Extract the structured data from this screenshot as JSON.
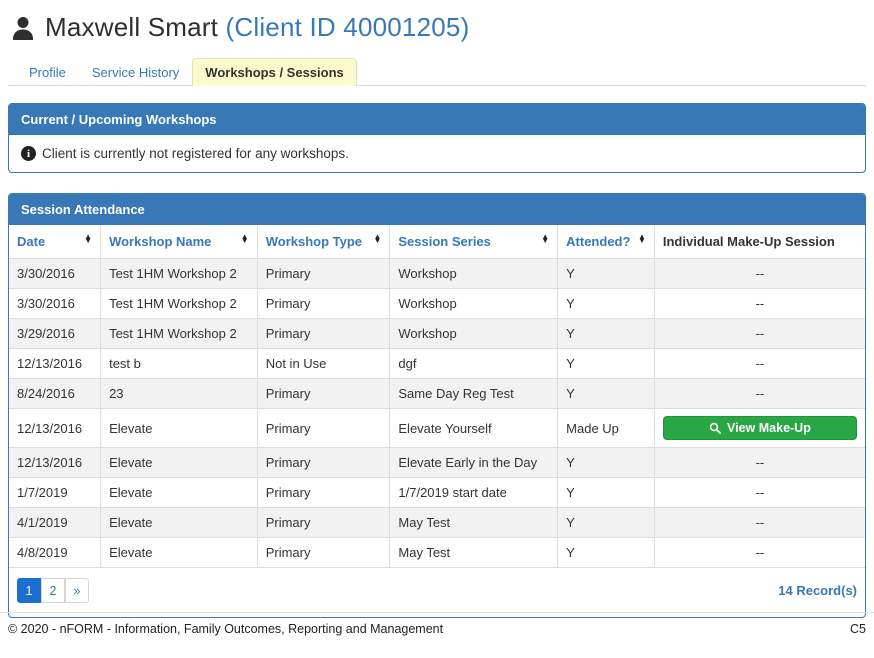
{
  "header": {
    "name": "Maxwell Smart",
    "client_id": "(Client ID 40001205)"
  },
  "tabs": [
    {
      "label": "Profile",
      "active": false
    },
    {
      "label": "Service History",
      "active": false
    },
    {
      "label": "Workshops / Sessions",
      "active": true
    }
  ],
  "panels": {
    "workshops": {
      "title": "Current / Upcoming Workshops",
      "message": "Client is currently not registered for any workshops."
    },
    "attendance": {
      "title": "Session Attendance",
      "columns": [
        {
          "label": "Date",
          "sortable": true
        },
        {
          "label": "Workshop Name",
          "sortable": true
        },
        {
          "label": "Workshop Type",
          "sortable": true
        },
        {
          "label": "Session Series",
          "sortable": true
        },
        {
          "label": "Attended?",
          "sortable": true
        },
        {
          "label": "Individual Make-Up Session",
          "sortable": false
        }
      ],
      "rows": [
        {
          "date": "3/30/2016",
          "workshop_name": "Test 1HM Workshop 2",
          "workshop_type": "Primary",
          "session_series": "Workshop",
          "attended": "Y",
          "make_up": "--"
        },
        {
          "date": "3/30/2016",
          "workshop_name": "Test 1HM Workshop 2",
          "workshop_type": "Primary",
          "session_series": "Workshop",
          "attended": "Y",
          "make_up": "--"
        },
        {
          "date": "3/29/2016",
          "workshop_name": "Test 1HM Workshop 2",
          "workshop_type": "Primary",
          "session_series": "Workshop",
          "attended": "Y",
          "make_up": "--"
        },
        {
          "date": "12/13/2016",
          "workshop_name": "test b",
          "workshop_type": "Not in Use",
          "session_series": "dgf",
          "attended": "Y",
          "make_up": "--"
        },
        {
          "date": "8/24/2016",
          "workshop_name": "23",
          "workshop_type": "Primary",
          "session_series": "Same Day Reg Test",
          "attended": "Y",
          "make_up": "--"
        },
        {
          "date": "12/13/2016",
          "workshop_name": "Elevate",
          "workshop_type": "Primary",
          "session_series": "Elevate Yourself",
          "attended": "Made Up",
          "make_up": "view"
        },
        {
          "date": "12/13/2016",
          "workshop_name": "Elevate",
          "workshop_type": "Primary",
          "session_series": "Elevate Early in the Day",
          "attended": "Y",
          "make_up": "--"
        },
        {
          "date": "1/7/2019",
          "workshop_name": "Elevate",
          "workshop_type": "Primary",
          "session_series": "1/7/2019 start date",
          "attended": "Y",
          "make_up": "--"
        },
        {
          "date": "4/1/2019",
          "workshop_name": "Elevate",
          "workshop_type": "Primary",
          "session_series": "May Test",
          "attended": "Y",
          "make_up": "--"
        },
        {
          "date": "4/8/2019",
          "workshop_name": "Elevate",
          "workshop_type": "Primary",
          "session_series": "May Test",
          "attended": "Y",
          "make_up": "--"
        }
      ],
      "make_up_button_label": "View Make-Up",
      "pagination": {
        "pages": [
          "1",
          "2",
          "»"
        ],
        "active_page": "1",
        "records_label": "14 Record(s)"
      }
    }
  },
  "footer": {
    "copyright": "© 2020 - nFORM - Information, Family Outcomes, Reporting and Management",
    "version": "C5"
  },
  "icons": {
    "user": "user-icon",
    "info": "info-icon",
    "sort": "sort-both-icon",
    "search": "search-icon"
  },
  "colors": {
    "accent_blue": "#3878b7",
    "active_page_blue": "#1b6fd0",
    "success_green": "#28a745",
    "active_tab_yellow": "#fcf9cd",
    "row_stripe": "#f2f2f2"
  }
}
